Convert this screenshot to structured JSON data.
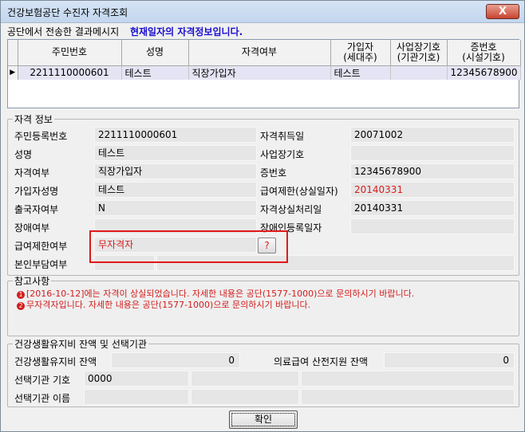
{
  "window": {
    "title": "건강보험공단 수진자 자격조회",
    "close_label": "X"
  },
  "message": {
    "label": "공단에서 전송한 결과메시지",
    "text": "현재일자의 자격정보입니다."
  },
  "grid": {
    "columns": [
      "주민번호",
      "성명",
      "자격여부",
      "가입자\n(세대주)",
      "사업장기호\n(기관기호)",
      "증번호\n(시설기호)"
    ],
    "rows": [
      [
        "2211110000601",
        "테스트",
        "직장가입자",
        "테스트",
        "",
        "12345678900"
      ]
    ],
    "row_indicator": "▶"
  },
  "qualification": {
    "legend": "자격 정보",
    "fields": {
      "rrn_label": "주민등록번호",
      "rrn": "2211110000601",
      "name_label": "성명",
      "name": "테스트",
      "qual_label": "자격여부",
      "qual": "직장가입자",
      "subscriber_label": "가입자성명",
      "subscriber": "테스트",
      "departure_label": "출국자여부",
      "departure": "N",
      "disability_label": "장애여부",
      "disability": "",
      "benefit_limit_label": "급여제한여부",
      "benefit_limit": "무자격자",
      "copay_label": "본인부담여부",
      "copay": "",
      "acq_date_label": "자격취득일",
      "acq_date": "20071002",
      "biz_code_label": "사업장기호",
      "biz_code": "",
      "card_no_label": "증번호",
      "card_no": "12345678900",
      "limit_date_label": "급여제한(상실일자)",
      "limit_date": "20140331",
      "loss_date_label": "자격상실처리일",
      "loss_date": "20140331",
      "disab_reg_label": "장애인등록일자",
      "disab_reg": ""
    },
    "help_button": "?"
  },
  "notes": {
    "legend": "참고사항",
    "items": [
      {
        "num": "1",
        "text": "[2016-10-12]에는 자격이 상실되었습니다. 자세한 내용은 공단(1577-1000)으로 문의하시기 바랍니다."
      },
      {
        "num": "2",
        "text": "무자격자입니다. 자세한 내용은 공단(1577-1000)으로 문의하시기 바랍니다."
      }
    ]
  },
  "health_fund": {
    "legend": "건강생활유지비 잔액 및 선택기관",
    "balance_label": "건강생활유지비 잔액",
    "balance": "0",
    "medical_label": "의료급여 산전지원 잔액",
    "medical": "0",
    "inst_code_label": "선택기관 기호",
    "inst_code": "0000",
    "inst_name_label": "선택기관 이름",
    "inst_name": ""
  },
  "ok_button": "확인",
  "colors": {
    "message": "#1a0fd0",
    "alert": "#d81e1e",
    "highlight_box": "#e01818"
  }
}
